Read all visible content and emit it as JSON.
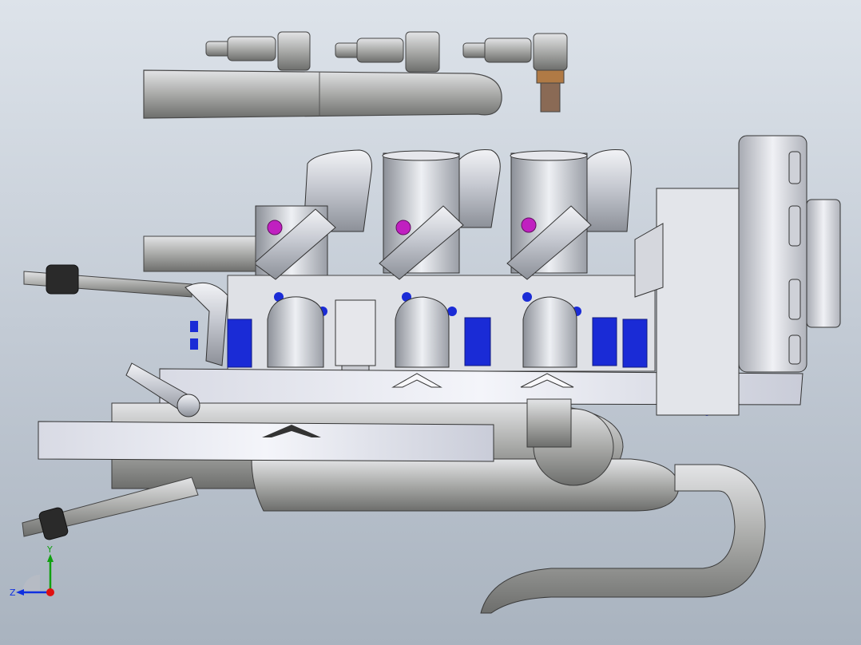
{
  "viewport": {
    "background_top": "#dde3ea",
    "background_bottom": "#a9b3bf"
  },
  "colors": {
    "metal": "#c9ccd4",
    "metal_dark": "#8a8e96",
    "metal_light": "#eef0f4",
    "accent_blue": "#1a2bd6",
    "accent_magenta": "#c020c0",
    "axis_x": "#e01010",
    "axis_y": "#10a010",
    "axis_z": "#1030e0"
  },
  "triad": {
    "y_label": "Y",
    "z_label": "Z"
  }
}
